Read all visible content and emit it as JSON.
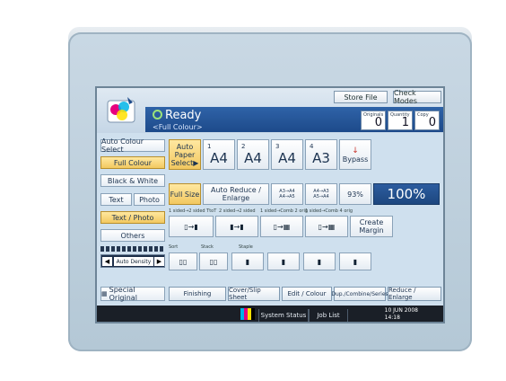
{
  "header": {
    "status": "Ready",
    "mode": "<Full Colour>",
    "store_file": "Store File",
    "check_modes": "Check Modes",
    "counters": [
      {
        "label": "Originals",
        "value": "0"
      },
      {
        "label": "Quantity",
        "value": "1"
      },
      {
        "label": "Copy",
        "value": "0"
      }
    ]
  },
  "left_panel": {
    "auto_colour_select": "Auto Colour Select",
    "full_colour": "Full Colour",
    "black_white": "Black & White",
    "text": "Text",
    "photo": "Photo",
    "text_photo": "Text / Photo",
    "others": "Others",
    "auto_density": "Auto Density",
    "special_original": "Special Original"
  },
  "paper": {
    "auto_paper_select": "Auto Paper Select▶",
    "trays": [
      {
        "num": "1",
        "size": "A4"
      },
      {
        "num": "2",
        "size": "A4"
      },
      {
        "num": "3",
        "size": "A4"
      },
      {
        "num": "4",
        "size": "A3"
      }
    ],
    "bypass": "Bypass"
  },
  "reduce": {
    "full_size": "Full Size",
    "auto_reduce": "Auto Reduce / Enlarge",
    "preset1": "A3→A4 A4→A5",
    "preset2": "A4→A3 A5→A4",
    "pct93": "93%",
    "pct100": "100%"
  },
  "duplex": {
    "labels": [
      "1 sided→2 sided TtoT",
      "2 sided→2 sided",
      "1 sided→Comb 2 orig",
      "1 sided→Comb 4 orig"
    ],
    "create_margin": "Create Margin"
  },
  "finish_labels": {
    "sort": "Sort",
    "stack": "Stack",
    "staple": "Staple"
  },
  "bottom_tabs": [
    "Finishing",
    "Cover/Slip Sheet",
    "Edit / Colour",
    "Dup./Combine/Series",
    "Reduce / Enlarge"
  ],
  "status_bar": {
    "system_status": "System Status",
    "job_list": "Job List",
    "date": "10 JUN 2008",
    "time": "14:18"
  },
  "colors": {
    "accent": "#1d4a8a",
    "selected": "#f2c860",
    "screen": "#cfe0ee"
  }
}
